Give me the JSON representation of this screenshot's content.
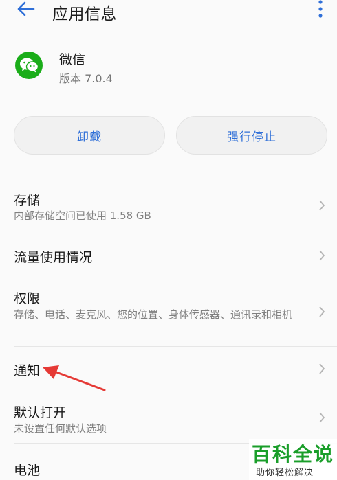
{
  "header": {
    "back_icon": "arrow-back-icon",
    "title": "应用信息",
    "more_icon": "more-vertical-icon"
  },
  "app": {
    "icon": "wechat-icon",
    "name": "微信",
    "version": "版本 7.0.4"
  },
  "actions": {
    "uninstall_label": "卸载",
    "force_stop_label": "强行停止"
  },
  "settings": [
    {
      "title": "存储",
      "subtitle": "内部存储空间已使用 1.58 GB"
    },
    {
      "title": "流量使用情况",
      "subtitle": ""
    },
    {
      "title": "权限",
      "subtitle": "存储、电话、麦克风、您的位置、身体传感器、通讯录和相机"
    },
    {
      "title": "通知",
      "subtitle": ""
    },
    {
      "title": "默认打开",
      "subtitle": "未设置任何默认选项"
    },
    {
      "title": "电池",
      "subtitle": ""
    }
  ],
  "watermark": {
    "title": "百科全说",
    "subtitle": "助你轻松解决"
  },
  "colors": {
    "accent": "#2f6fd8",
    "wechat_green": "#1aad19",
    "annotation_red": "#e53935",
    "watermark_green": "#1a9e2a"
  }
}
